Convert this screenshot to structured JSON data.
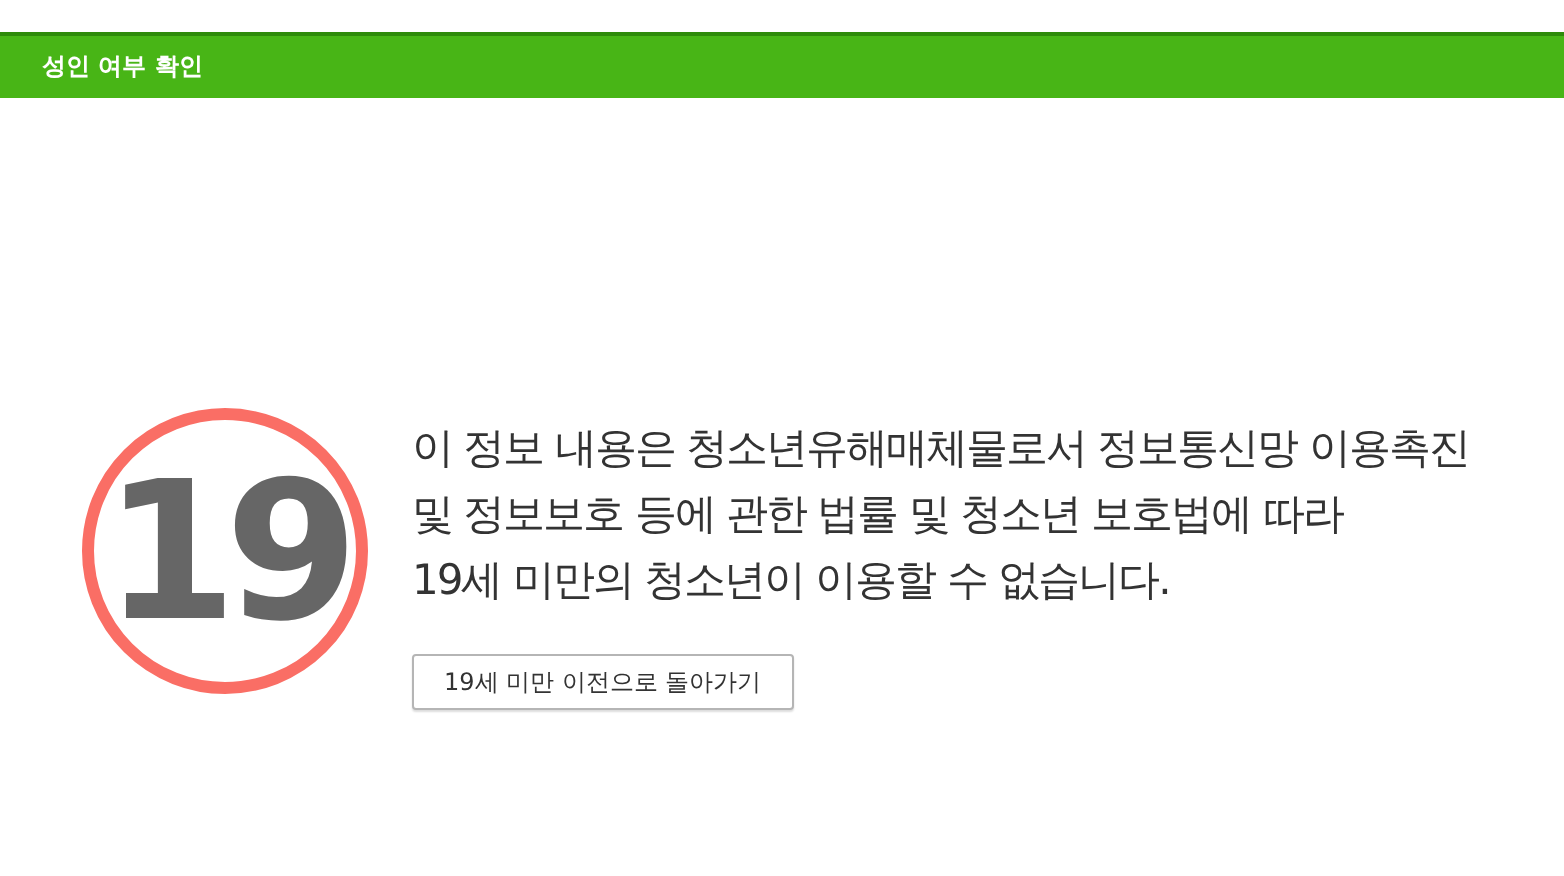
{
  "header": {
    "title": "성인 여부 확인"
  },
  "rating_badge": {
    "label": "19"
  },
  "notice": {
    "lines": [
      "이 정보 내용은 청소년유해매체물로서 정보통신망 이용촉진",
      "및 정보보호 등에 관한 법률 및 청소년 보호법에 따라",
      "19세 미만의 청소년이 이용할 수 없습니다."
    ]
  },
  "buttons": [
    "19세 미만 이전으로 돌아가기"
  ]
}
